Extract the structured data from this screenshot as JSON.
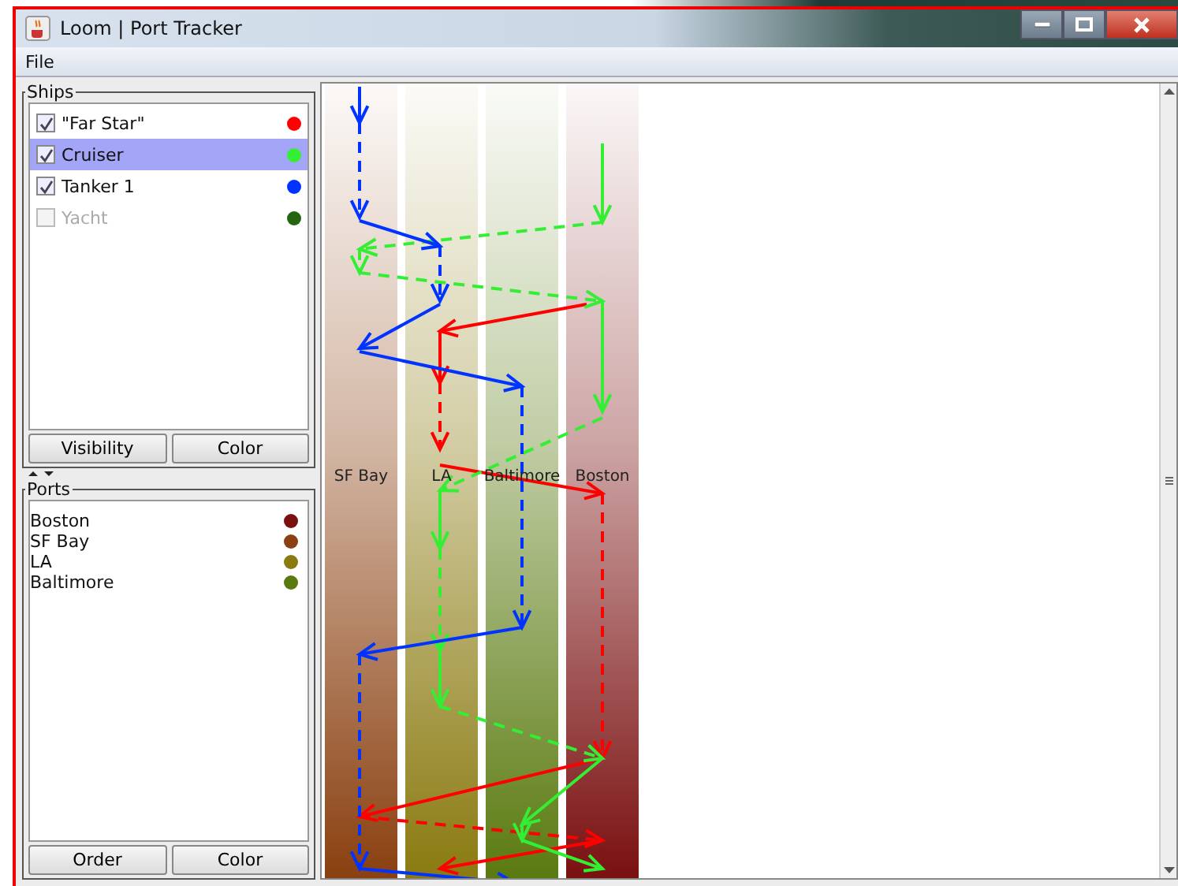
{
  "window": {
    "title": "Loom | Port Tracker"
  },
  "menu": [
    "File"
  ],
  "ships": {
    "title": "Ships",
    "items": [
      {
        "name": "\"Far Star\"",
        "checked": true,
        "selected": false,
        "color": "#ff0000"
      },
      {
        "name": "Cruiser",
        "checked": true,
        "selected": true,
        "color": "#33ee33"
      },
      {
        "name": "Tanker 1",
        "checked": true,
        "selected": false,
        "color": "#0033ff"
      },
      {
        "name": "Yacht",
        "checked": false,
        "selected": false,
        "color": "#226611"
      }
    ],
    "buttons": [
      "Visibility",
      "Color"
    ]
  },
  "ports": {
    "title": "Ports",
    "items": [
      {
        "name": "Boston",
        "color": "#7a1010"
      },
      {
        "name": "SF Bay",
        "color": "#8a4010"
      },
      {
        "name": "LA",
        "color": "#8a7a10"
      },
      {
        "name": "Baltimore",
        "color": "#5a7a10"
      }
    ],
    "buttons": [
      "Order",
      "Color"
    ]
  },
  "lanes": [
    {
      "label": "SF Bay",
      "color": "#8a4010"
    },
    {
      "label": "LA",
      "color": "#8a7a10"
    },
    {
      "label": "Baltimore",
      "color": "#5a7a10"
    },
    {
      "label": "Boston",
      "color": "#7a1010"
    }
  ]
}
